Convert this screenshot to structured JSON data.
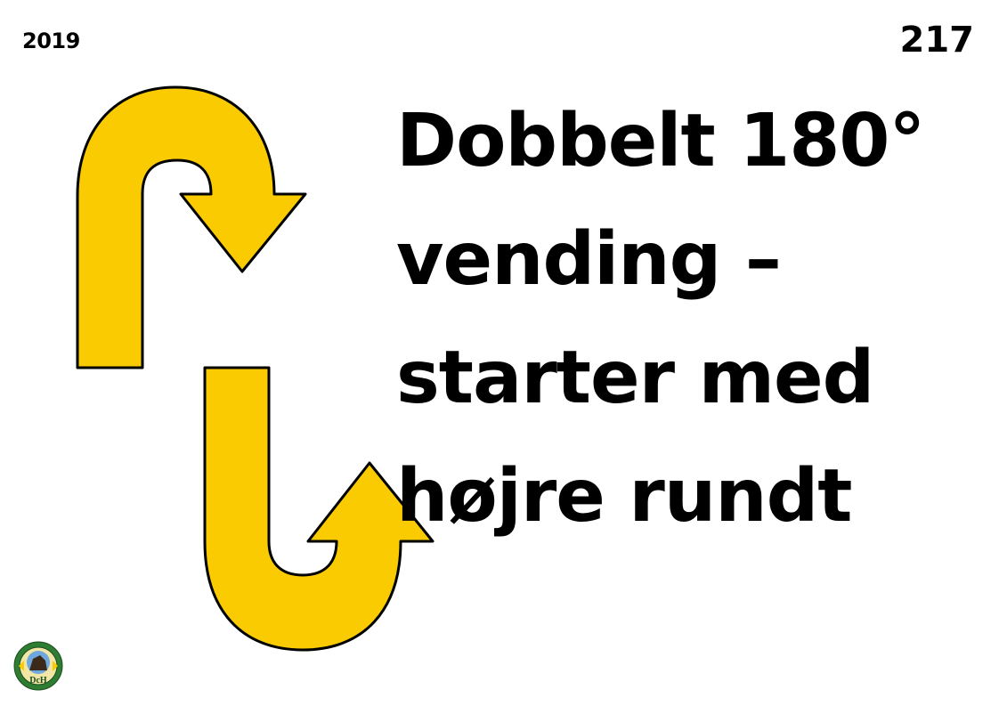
{
  "sign": {
    "year": "2019",
    "number": "217",
    "title_lines": [
      "Dobbelt 180°",
      "vending –",
      "starter med",
      "højre rundt"
    ],
    "logo_text": "DcH"
  },
  "colors": {
    "arrow_fill": "#F9CB00",
    "arrow_stroke": "#000000",
    "text": "#000000",
    "background": "#FFFFFF",
    "logo_green": "#2E7D32"
  },
  "icons": {
    "upper_arrow": "u-turn-right-arrow-icon",
    "lower_arrow": "u-turn-up-arrow-icon",
    "logo": "dch-logo-icon"
  }
}
